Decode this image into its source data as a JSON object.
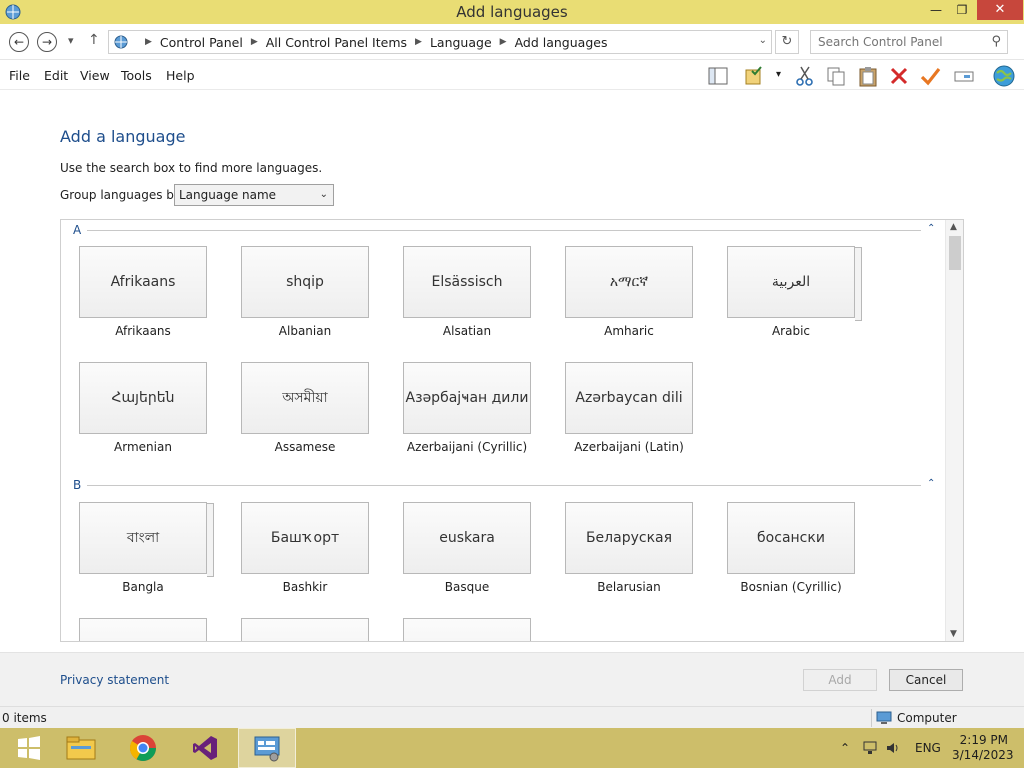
{
  "window": {
    "title": "Add languages",
    "minimize": "—",
    "maximize": "❐",
    "close": "✕"
  },
  "address": {
    "breadcrumbs": [
      "Control Panel",
      "All Control Panel Items",
      "Language",
      "Add languages"
    ],
    "search_placeholder": "Search Control Panel"
  },
  "menu": {
    "items": [
      "File",
      "Edit",
      "View",
      "Tools",
      "Help"
    ]
  },
  "page": {
    "heading": "Add a language",
    "hint": "Use the search box to find more languages.",
    "group_label": "Group languages by:",
    "group_value": "Language name"
  },
  "sections": [
    {
      "letter": "A",
      "tiles": [
        {
          "native": "Afrikaans",
          "name": "Afrikaans"
        },
        {
          "native": "shqip",
          "name": "Albanian"
        },
        {
          "native": "Elsässisch",
          "name": "Alsatian"
        },
        {
          "native": "አማርኛ",
          "name": "Amharic"
        },
        {
          "native": "العربية",
          "name": "Arabic"
        },
        {
          "native": "Հայերեն",
          "name": "Armenian"
        },
        {
          "native": "অসমীয়া",
          "name": "Assamese"
        },
        {
          "native": "Азәрбајҹан дили",
          "name": "Azerbaijani (Cyrillic)"
        },
        {
          "native": "Azərbaycan dili",
          "name": "Azerbaijani (Latin)"
        }
      ]
    },
    {
      "letter": "B",
      "tiles": [
        {
          "native": "বাংলা",
          "name": "Bangla"
        },
        {
          "native": "Башҡорт",
          "name": "Bashkir"
        },
        {
          "native": "euskara",
          "name": "Basque"
        },
        {
          "native": "Беларуская",
          "name": "Belarusian"
        },
        {
          "native": "босански",
          "name": "Bosnian (Cyrillic)"
        }
      ]
    }
  ],
  "footer": {
    "privacy": "Privacy statement",
    "add": "Add",
    "cancel": "Cancel"
  },
  "status": {
    "items": "0 items",
    "location": "Computer"
  },
  "taskbar": {
    "language": "ENG",
    "time": "2:19 PM",
    "date": "3/14/2023"
  },
  "colors": {
    "titlebar": "#e9dd74",
    "taskbar": "#cdbe6a",
    "link": "#1e4e8c"
  }
}
